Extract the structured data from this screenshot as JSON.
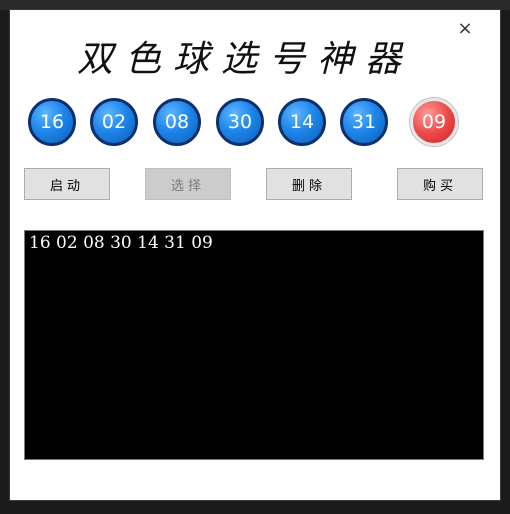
{
  "window": {
    "title": "双色球选号神器",
    "close_glyph": "×"
  },
  "balls": {
    "blue": [
      "16",
      "02",
      "08",
      "30",
      "14",
      "31"
    ],
    "red": "09"
  },
  "buttons": {
    "start": "启动",
    "select": "选择",
    "delete": "删除",
    "buy": "购买"
  },
  "output": {
    "text": "16 02 08 30 14 31 09"
  },
  "colors": {
    "blue_ball": "#1e86ea",
    "red_ball": "#ee4a4a",
    "output_bg": "#000000",
    "output_text": "#ffffff"
  }
}
